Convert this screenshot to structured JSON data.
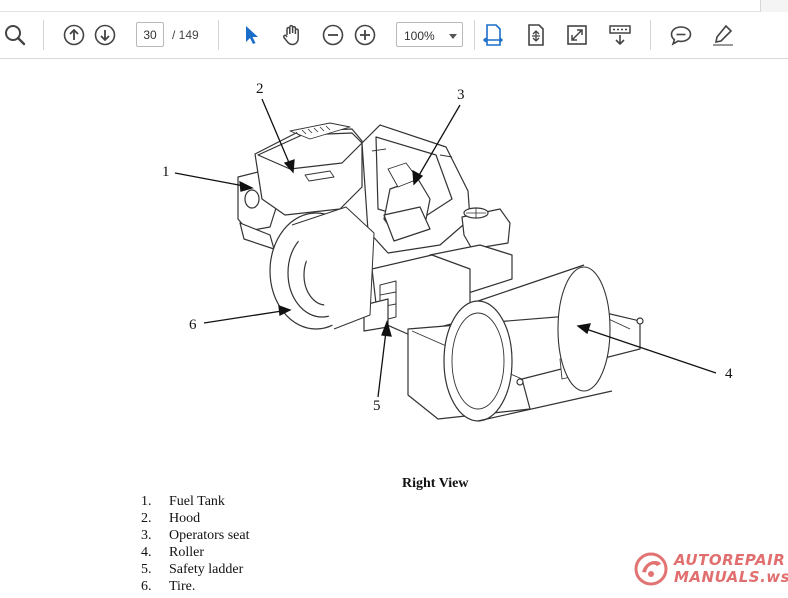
{
  "toolbar": {
    "page_current": "30",
    "page_total": "/ 149",
    "zoom": "100%",
    "icons": [
      "search-icon",
      "prev-page-icon",
      "next-page-icon",
      "select-cursor-icon",
      "hand-tool-icon",
      "zoom-out-icon",
      "zoom-in-icon",
      "fit-width-icon",
      "fit-page-icon",
      "full-screen-icon",
      "scroll-mode-icon",
      "comment-icon",
      "highlight-icon"
    ],
    "accent": "#1b6ec8"
  },
  "document": {
    "callouts": [
      "1",
      "2",
      "3",
      "4",
      "5",
      "6"
    ],
    "caption": "Right View",
    "legend": [
      {
        "num": "1.",
        "label": "Fuel Tank"
      },
      {
        "num": "2.",
        "label": "Hood"
      },
      {
        "num": "3.",
        "label": "Operators seat"
      },
      {
        "num": "4.",
        "label": "Roller"
      },
      {
        "num": "5.",
        "label": "Safety ladder"
      },
      {
        "num": "6.",
        "label": "Tire."
      }
    ]
  },
  "watermark": {
    "line1": "AUTOREPAIR",
    "line2": "MANUALS.ws",
    "color": "#d63838"
  }
}
